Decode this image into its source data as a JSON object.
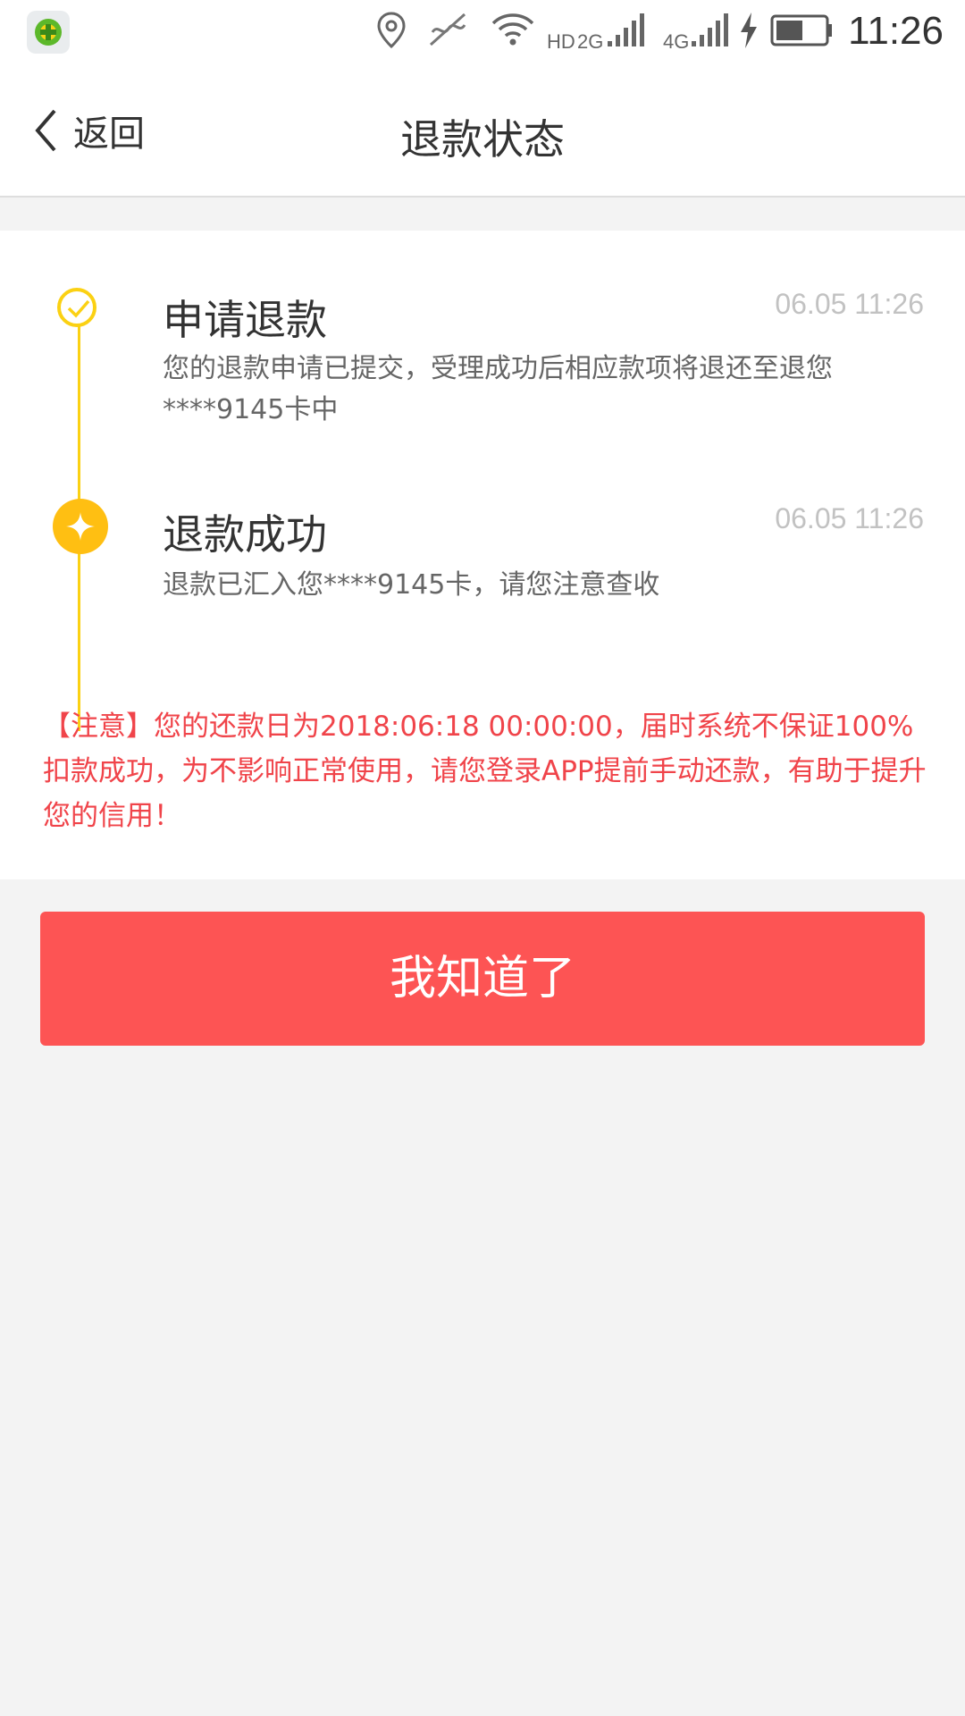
{
  "status_bar": {
    "network_hd": "HD",
    "network_2g": "2G",
    "network_4g": "4G",
    "time": "11:26",
    "icons": [
      "app-icon",
      "location-icon",
      "vibrate-off-icon",
      "wifi-icon",
      "signal-icon",
      "charging-icon",
      "battery-icon"
    ],
    "battery_level": 0.55
  },
  "nav": {
    "back_label": "返回",
    "title": "退款状态"
  },
  "timeline": {
    "steps": [
      {
        "title": "申请退款",
        "time": "06.05 11:26",
        "description": "您的退款申请已提交，受理成功后相应款项将退还至退您****9145卡中"
      },
      {
        "title": "退款成功",
        "time": "06.05 11:26",
        "description": "退款已汇入您****9145卡，请您注意查收"
      }
    ]
  },
  "notice": "【注意】您的还款日为2018:06:18 00:00:00，届时系统不保证100%扣款成功，为不影响正常使用，请您登录APP提前手动还款，有助于提升您的信用！",
  "confirm_button": "我知道了",
  "colors": {
    "accent_yellow": "#fbd113",
    "accent_orange": "#ffbf12",
    "notice_red": "#f0444a",
    "button_red": "#fd5454",
    "page_bg": "#f3f3f3"
  }
}
